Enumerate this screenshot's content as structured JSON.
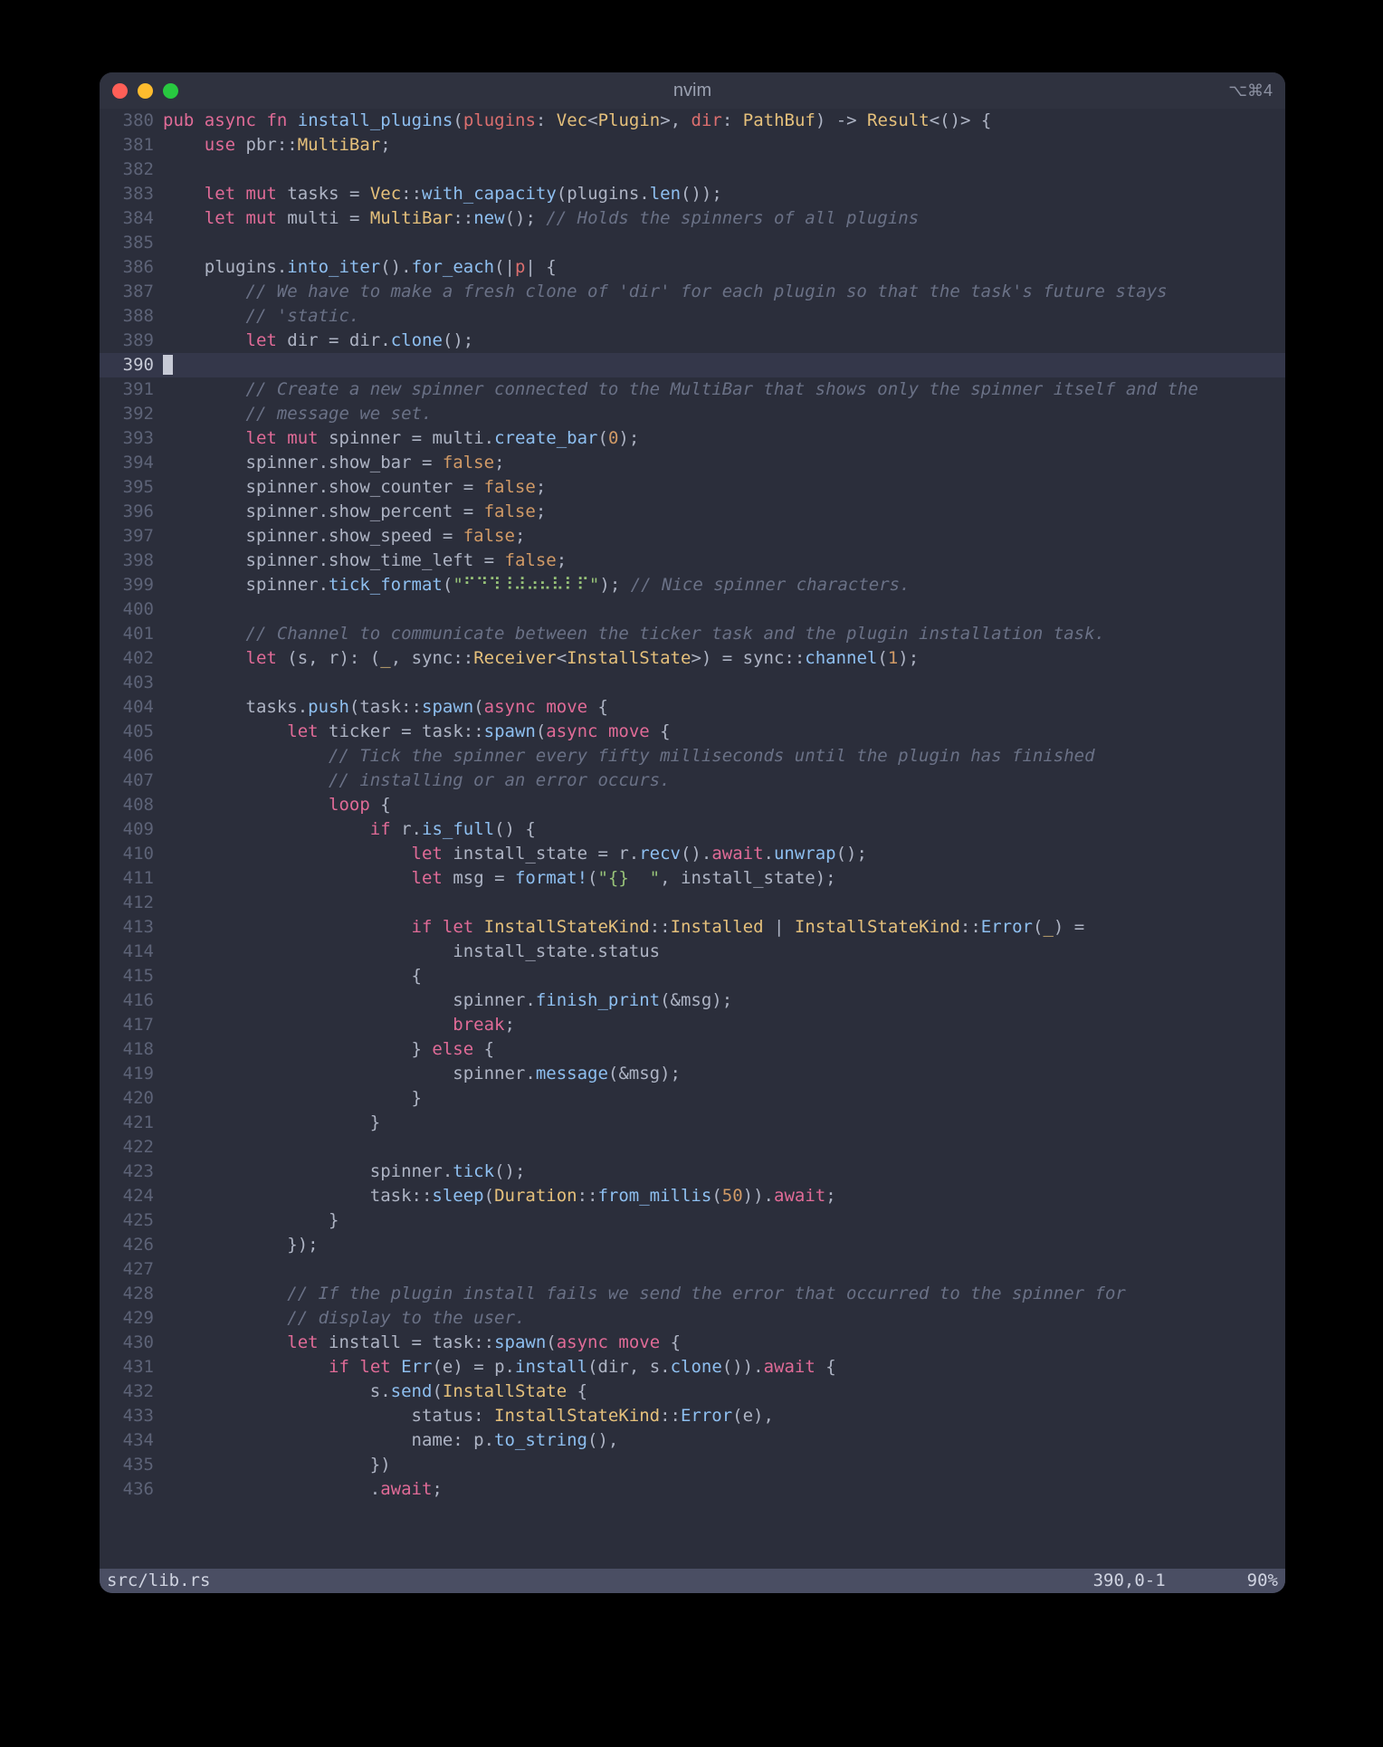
{
  "window": {
    "title": "nvim",
    "shortcut_hint": "⌥⌘4"
  },
  "editor": {
    "first_line_no": 380,
    "current_line_no": 390,
    "lines": [
      [
        [
          "kw",
          "pub"
        ],
        [
          "punc",
          " "
        ],
        [
          "kw",
          "async"
        ],
        [
          "punc",
          " "
        ],
        [
          "kw",
          "fn"
        ],
        [
          "punc",
          " "
        ],
        [
          "fnname",
          "install_plugins"
        ],
        [
          "punc",
          "("
        ],
        [
          "arg",
          "plugins"
        ],
        [
          "punc",
          ": "
        ],
        [
          "ty",
          "Vec"
        ],
        [
          "punc",
          "<"
        ],
        [
          "ty",
          "Plugin"
        ],
        [
          "punc",
          ">, "
        ],
        [
          "arg",
          "dir"
        ],
        [
          "punc",
          ": "
        ],
        [
          "ty",
          "PathBuf"
        ],
        [
          "punc",
          ") -> "
        ],
        [
          "ty",
          "Result"
        ],
        [
          "punc",
          "<()> {"
        ]
      ],
      [
        [
          "punc",
          "    "
        ],
        [
          "kw",
          "use"
        ],
        [
          "punc",
          " pbr::"
        ],
        [
          "ty",
          "MultiBar"
        ],
        [
          "punc",
          ";"
        ]
      ],
      [
        [
          "punc",
          ""
        ]
      ],
      [
        [
          "punc",
          "    "
        ],
        [
          "kw",
          "let"
        ],
        [
          "punc",
          " "
        ],
        [
          "kw",
          "mut"
        ],
        [
          "punc",
          " tasks = "
        ],
        [
          "ty",
          "Vec"
        ],
        [
          "punc",
          "::"
        ],
        [
          "fnname",
          "with_capacity"
        ],
        [
          "punc",
          "(plugins."
        ],
        [
          "fnname",
          "len"
        ],
        [
          "punc",
          "());"
        ]
      ],
      [
        [
          "punc",
          "    "
        ],
        [
          "kw",
          "let"
        ],
        [
          "punc",
          " "
        ],
        [
          "kw",
          "mut"
        ],
        [
          "punc",
          " multi = "
        ],
        [
          "ty",
          "MultiBar"
        ],
        [
          "punc",
          "::"
        ],
        [
          "fnname",
          "new"
        ],
        [
          "punc",
          "(); "
        ],
        [
          "cmt",
          "// Holds the spinners of all plugins"
        ]
      ],
      [
        [
          "punc",
          ""
        ]
      ],
      [
        [
          "punc",
          "    plugins."
        ],
        [
          "fnname",
          "into_iter"
        ],
        [
          "punc",
          "()."
        ],
        [
          "fnname",
          "for_each"
        ],
        [
          "punc",
          "(|"
        ],
        [
          "arg",
          "p"
        ],
        [
          "punc",
          "| {"
        ]
      ],
      [
        [
          "punc",
          "        "
        ],
        [
          "cmt",
          "// We have to make a fresh clone of 'dir' for each plugin so that the task's future stays"
        ]
      ],
      [
        [
          "punc",
          "        "
        ],
        [
          "cmt",
          "// 'static."
        ]
      ],
      [
        [
          "punc",
          "        "
        ],
        [
          "kw",
          "let"
        ],
        [
          "punc",
          " dir = dir."
        ],
        [
          "fnname",
          "clone"
        ],
        [
          "punc",
          "();"
        ]
      ],
      [
        [
          "cursor",
          ""
        ]
      ],
      [
        [
          "punc",
          "        "
        ],
        [
          "cmt",
          "// Create a new spinner connected to the MultiBar that shows only the spinner itself and the"
        ]
      ],
      [
        [
          "punc",
          "        "
        ],
        [
          "cmt",
          "// message we set."
        ]
      ],
      [
        [
          "punc",
          "        "
        ],
        [
          "kw",
          "let"
        ],
        [
          "punc",
          " "
        ],
        [
          "kw",
          "mut"
        ],
        [
          "punc",
          " spinner = multi."
        ],
        [
          "fnname",
          "create_bar"
        ],
        [
          "punc",
          "("
        ],
        [
          "num",
          "0"
        ],
        [
          "punc",
          ");"
        ]
      ],
      [
        [
          "punc",
          "        spinner.show_bar = "
        ],
        [
          "num",
          "false"
        ],
        [
          "punc",
          ";"
        ]
      ],
      [
        [
          "punc",
          "        spinner.show_counter = "
        ],
        [
          "num",
          "false"
        ],
        [
          "punc",
          ";"
        ]
      ],
      [
        [
          "punc",
          "        spinner.show_percent = "
        ],
        [
          "num",
          "false"
        ],
        [
          "punc",
          ";"
        ]
      ],
      [
        [
          "punc",
          "        spinner.show_speed = "
        ],
        [
          "num",
          "false"
        ],
        [
          "punc",
          ";"
        ]
      ],
      [
        [
          "punc",
          "        spinner.show_time_left = "
        ],
        [
          "num",
          "false"
        ],
        [
          "punc",
          ";"
        ]
      ],
      [
        [
          "punc",
          "        spinner."
        ],
        [
          "fnname",
          "tick_format"
        ],
        [
          "punc",
          "("
        ],
        [
          "str",
          "\"⠋⠙⠹⠸⠼⠴⠦⠧⠇⠏\""
        ],
        [
          "punc",
          "); "
        ],
        [
          "cmt",
          "// Nice spinner characters."
        ]
      ],
      [
        [
          "punc",
          ""
        ]
      ],
      [
        [
          "punc",
          "        "
        ],
        [
          "cmt",
          "// Channel to communicate between the ticker task and the plugin installation task."
        ]
      ],
      [
        [
          "punc",
          "        "
        ],
        [
          "kw",
          "let"
        ],
        [
          "punc",
          " (s, r): ("
        ],
        [
          "ty",
          "_"
        ],
        [
          "punc",
          ", sync::"
        ],
        [
          "ty",
          "Receiver"
        ],
        [
          "punc",
          "<"
        ],
        [
          "ty",
          "InstallState"
        ],
        [
          "punc",
          ">) = sync::"
        ],
        [
          "fnname",
          "channel"
        ],
        [
          "punc",
          "("
        ],
        [
          "num",
          "1"
        ],
        [
          "punc",
          ");"
        ]
      ],
      [
        [
          "punc",
          ""
        ]
      ],
      [
        [
          "punc",
          "        tasks."
        ],
        [
          "fnname",
          "push"
        ],
        [
          "punc",
          "(task::"
        ],
        [
          "fnname",
          "spawn"
        ],
        [
          "punc",
          "("
        ],
        [
          "kw",
          "async"
        ],
        [
          "punc",
          " "
        ],
        [
          "kw",
          "move"
        ],
        [
          "punc",
          " {"
        ]
      ],
      [
        [
          "punc",
          "            "
        ],
        [
          "kw",
          "let"
        ],
        [
          "punc",
          " ticker = task::"
        ],
        [
          "fnname",
          "spawn"
        ],
        [
          "punc",
          "("
        ],
        [
          "kw",
          "async"
        ],
        [
          "punc",
          " "
        ],
        [
          "kw",
          "move"
        ],
        [
          "punc",
          " {"
        ]
      ],
      [
        [
          "punc",
          "                "
        ],
        [
          "cmt",
          "// Tick the spinner every fifty milliseconds until the plugin has finished"
        ]
      ],
      [
        [
          "punc",
          "                "
        ],
        [
          "cmt",
          "// installing or an error occurs."
        ]
      ],
      [
        [
          "punc",
          "                "
        ],
        [
          "kw",
          "loop"
        ],
        [
          "punc",
          " {"
        ]
      ],
      [
        [
          "punc",
          "                    "
        ],
        [
          "kw",
          "if"
        ],
        [
          "punc",
          " r."
        ],
        [
          "fnname",
          "is_full"
        ],
        [
          "punc",
          "() {"
        ]
      ],
      [
        [
          "punc",
          "                        "
        ],
        [
          "kw",
          "let"
        ],
        [
          "punc",
          " install_state = r."
        ],
        [
          "fnname",
          "recv"
        ],
        [
          "punc",
          "()."
        ],
        [
          "kw",
          "await"
        ],
        [
          "punc",
          "."
        ],
        [
          "fnname",
          "unwrap"
        ],
        [
          "punc",
          "();"
        ]
      ],
      [
        [
          "punc",
          "                        "
        ],
        [
          "kw",
          "let"
        ],
        [
          "punc",
          " msg = "
        ],
        [
          "fnname",
          "format!"
        ],
        [
          "punc",
          "("
        ],
        [
          "str",
          "\"{}  \""
        ],
        [
          "punc",
          ", install_state);"
        ]
      ],
      [
        [
          "punc",
          ""
        ]
      ],
      [
        [
          "punc",
          "                        "
        ],
        [
          "kw",
          "if"
        ],
        [
          "punc",
          " "
        ],
        [
          "kw",
          "let"
        ],
        [
          "punc",
          " "
        ],
        [
          "ty",
          "InstallStateKind"
        ],
        [
          "punc",
          "::"
        ],
        [
          "ty",
          "Installed"
        ],
        [
          "punc",
          " | "
        ],
        [
          "ty",
          "InstallStateKind"
        ],
        [
          "punc",
          "::"
        ],
        [
          "fnname",
          "Error"
        ],
        [
          "punc",
          "("
        ],
        [
          "ty",
          "_"
        ],
        [
          "punc",
          ") ="
        ]
      ],
      [
        [
          "punc",
          "                            install_state.status"
        ]
      ],
      [
        [
          "punc",
          "                        {"
        ]
      ],
      [
        [
          "punc",
          "                            spinner."
        ],
        [
          "fnname",
          "finish_print"
        ],
        [
          "punc",
          "(&msg);"
        ]
      ],
      [
        [
          "punc",
          "                            "
        ],
        [
          "kw",
          "break"
        ],
        [
          "punc",
          ";"
        ]
      ],
      [
        [
          "punc",
          "                        } "
        ],
        [
          "kw",
          "else"
        ],
        [
          "punc",
          " {"
        ]
      ],
      [
        [
          "punc",
          "                            spinner."
        ],
        [
          "fnname",
          "message"
        ],
        [
          "punc",
          "(&msg);"
        ]
      ],
      [
        [
          "punc",
          "                        }"
        ]
      ],
      [
        [
          "punc",
          "                    }"
        ]
      ],
      [
        [
          "punc",
          ""
        ]
      ],
      [
        [
          "punc",
          "                    spinner."
        ],
        [
          "fnname",
          "tick"
        ],
        [
          "punc",
          "();"
        ]
      ],
      [
        [
          "punc",
          "                    task::"
        ],
        [
          "fnname",
          "sleep"
        ],
        [
          "punc",
          "("
        ],
        [
          "ty",
          "Duration"
        ],
        [
          "punc",
          "::"
        ],
        [
          "fnname",
          "from_millis"
        ],
        [
          "punc",
          "("
        ],
        [
          "num",
          "50"
        ],
        [
          "punc",
          "))."
        ],
        [
          "kw",
          "await"
        ],
        [
          "punc",
          ";"
        ]
      ],
      [
        [
          "punc",
          "                }"
        ]
      ],
      [
        [
          "punc",
          "            });"
        ]
      ],
      [
        [
          "punc",
          ""
        ]
      ],
      [
        [
          "punc",
          "            "
        ],
        [
          "cmt",
          "// If the plugin install fails we send the error that occurred to the spinner for"
        ]
      ],
      [
        [
          "punc",
          "            "
        ],
        [
          "cmt",
          "// display to the user."
        ]
      ],
      [
        [
          "punc",
          "            "
        ],
        [
          "kw",
          "let"
        ],
        [
          "punc",
          " install = task::"
        ],
        [
          "fnname",
          "spawn"
        ],
        [
          "punc",
          "("
        ],
        [
          "kw",
          "async"
        ],
        [
          "punc",
          " "
        ],
        [
          "kw",
          "move"
        ],
        [
          "punc",
          " {"
        ]
      ],
      [
        [
          "punc",
          "                "
        ],
        [
          "kw",
          "if"
        ],
        [
          "punc",
          " "
        ],
        [
          "kw",
          "let"
        ],
        [
          "punc",
          " "
        ],
        [
          "fnname",
          "Err"
        ],
        [
          "punc",
          "(e) = p."
        ],
        [
          "fnname",
          "install"
        ],
        [
          "punc",
          "(dir, s."
        ],
        [
          "fnname",
          "clone"
        ],
        [
          "punc",
          "())."
        ],
        [
          "kw",
          "await"
        ],
        [
          "punc",
          " {"
        ]
      ],
      [
        [
          "punc",
          "                    s."
        ],
        [
          "fnname",
          "send"
        ],
        [
          "punc",
          "("
        ],
        [
          "ty",
          "InstallState"
        ],
        [
          "punc",
          " {"
        ]
      ],
      [
        [
          "punc",
          "                        status: "
        ],
        [
          "ty",
          "InstallStateKind"
        ],
        [
          "punc",
          "::"
        ],
        [
          "fnname",
          "Error"
        ],
        [
          "punc",
          "(e),"
        ]
      ],
      [
        [
          "punc",
          "                        name: p."
        ],
        [
          "fnname",
          "to_string"
        ],
        [
          "punc",
          "(),"
        ]
      ],
      [
        [
          "punc",
          "                    })"
        ]
      ],
      [
        [
          "punc",
          "                    ."
        ],
        [
          "kw",
          "await"
        ],
        [
          "punc",
          ";"
        ]
      ]
    ]
  },
  "statusbar": {
    "file": "src/lib.rs",
    "position": "390,0-1",
    "percent": "90%"
  }
}
